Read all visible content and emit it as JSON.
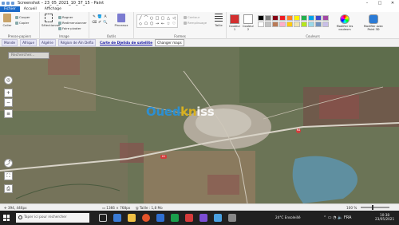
{
  "app": {
    "window_title": "Screenshot – 23_05_2021_10_37_15 - Paint",
    "window_buttons": {
      "minimize": "–",
      "maximize": "□",
      "close": "✕"
    }
  },
  "menu": {
    "tabs": [
      "Fichier",
      "Accueil",
      "Affichage"
    ]
  },
  "ribbon": {
    "clipboard": {
      "group": "Presse-papiers",
      "paste": "Coller",
      "cut": "Couper",
      "copy": "Copier"
    },
    "image": {
      "group": "Image",
      "select": "Sélectionner",
      "crop": "Rogner",
      "resize": "Redimensionner",
      "rotate": "Faire pivoter"
    },
    "tools": {
      "group": "Outils",
      "items": [
        "✎",
        "🪣",
        "A",
        "⌫",
        "✐",
        "🔍"
      ],
      "brushes": "Pinceaux"
    },
    "shapes": {
      "group": "Formes",
      "items": [
        "╱",
        "⌒",
        "○",
        "□",
        "▢",
        "△",
        "◁",
        "◇",
        "⬠",
        "⬡",
        "→",
        "←",
        "☆",
        "♡"
      ],
      "outline": "Contour",
      "fill": "Remplissage",
      "size": "Taille"
    },
    "colors": {
      "group": "Couleurs",
      "color1": "Couleur 1",
      "color2": "Couleur 2",
      "edit_colors": "Modifier les couleurs",
      "edit_paint3d": "Modifier avec Paint 3D",
      "color1_value": "#d32f2f",
      "color2_value": "#ffffff",
      "palette": [
        "#000000",
        "#7f7f7f",
        "#880015",
        "#ed1c24",
        "#ff7f27",
        "#fff200",
        "#22b14c",
        "#00a2e8",
        "#3f48cc",
        "#a349a4",
        "#ffffff",
        "#c3c3c3",
        "#b97a57",
        "#ffaec9",
        "#ffc90e",
        "#efe4b0",
        "#b5e61d",
        "#99d9ea",
        "#7092be",
        "#c8bfe7"
      ]
    }
  },
  "map": {
    "breadcrumbs": [
      "Monde",
      "Afrique",
      "Algérie",
      "Région de Aïn Defla"
    ],
    "title": "Carte de Djelida de satellite",
    "change_map": "Changer maps",
    "search_placeholder": "Rechercher...",
    "watermark": {
      "part1": "Oued",
      "part2": "kn",
      "part3": "iss"
    },
    "route_badges": [
      "A1",
      "N4"
    ],
    "controls": [
      "+",
      "−",
      "≡"
    ]
  },
  "status": {
    "coords": "394, 446px",
    "dimensions": "1366 × 768px",
    "size": "Taille : 1,8 Mo",
    "zoom": "100 %"
  },
  "taskbar": {
    "search_placeholder": "Taper ici pour rechercher",
    "weather": "24°C Ensoleillé",
    "time": "10:38",
    "date": "23/05/2021"
  }
}
